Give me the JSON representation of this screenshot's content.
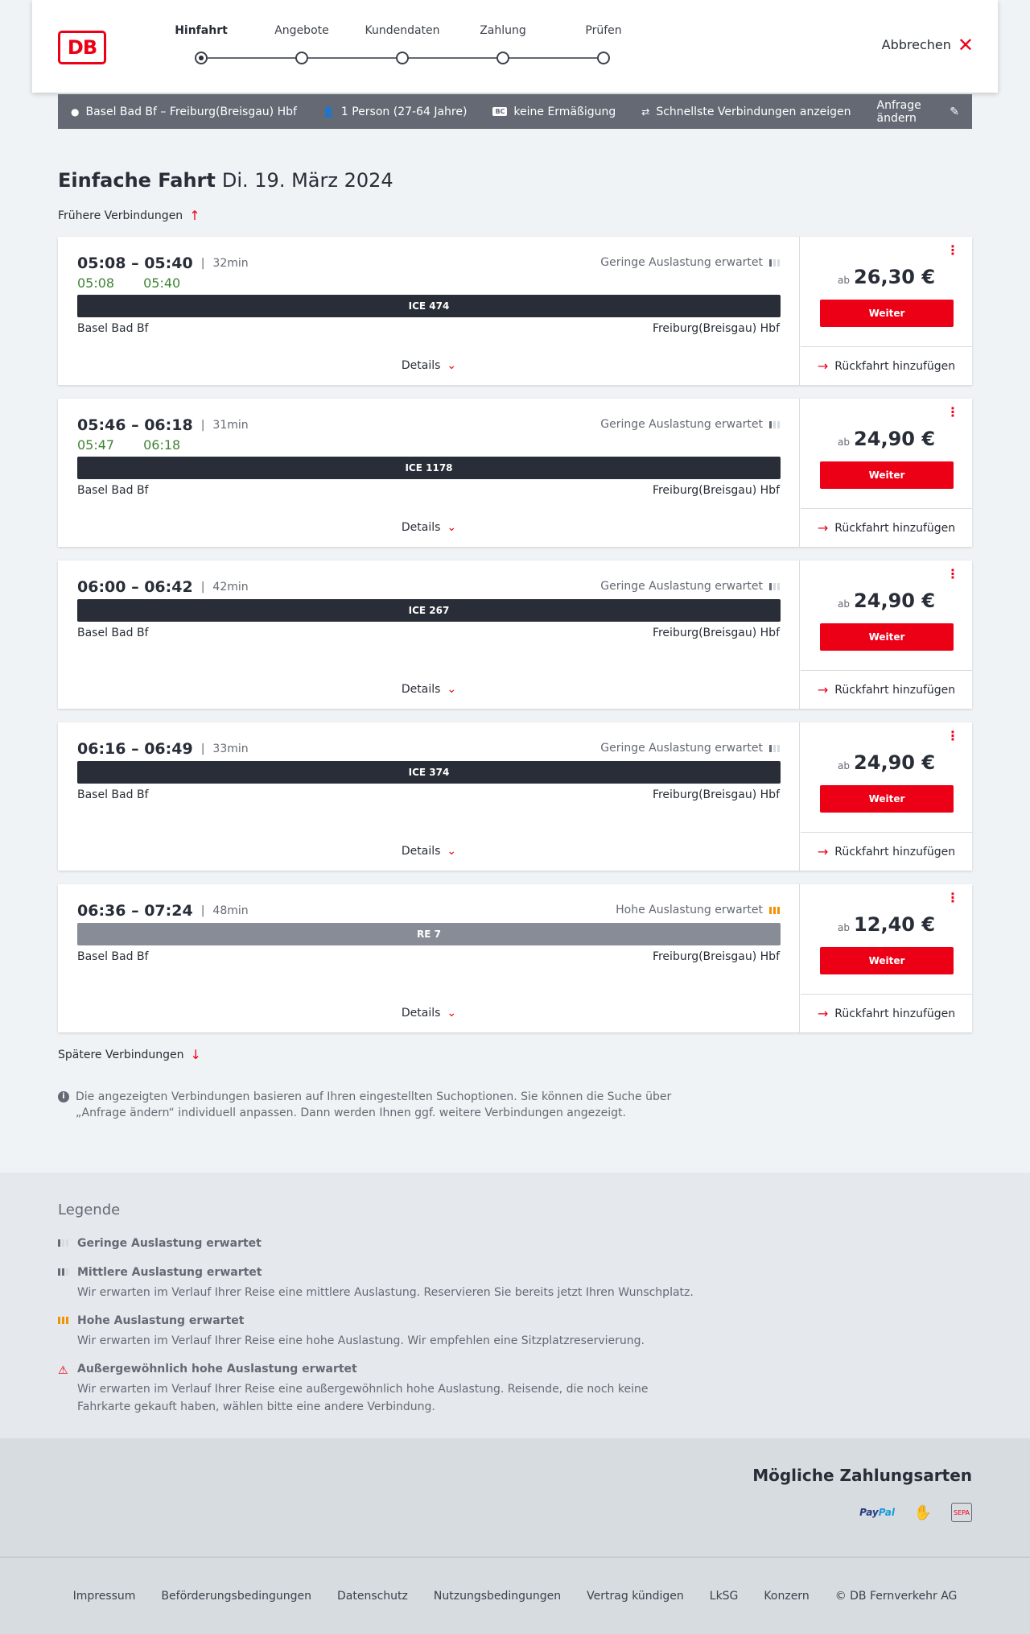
{
  "header": {
    "logo": "DB",
    "steps": [
      "Hinfahrt",
      "Angebote",
      "Kundendaten",
      "Zahlung",
      "Prüfen"
    ],
    "active_step": "Hinfahrt",
    "cancel_label": "Abbrechen"
  },
  "search": {
    "route": "Basel Bad Bf – Freiburg(Breisgau) Hbf",
    "passengers": "1 Person (27-64 Jahre)",
    "discount": "keine Ermäßigung",
    "fastest": "Schnellste Verbindungen anzeigen",
    "change": "Anfrage ändern",
    "bc_badge": "BC"
  },
  "page": {
    "title": "Einfache Fahrt",
    "date": "Di. 19. März 2024",
    "earlier": "Frühere Verbindungen",
    "later": "Spätere Verbindungen",
    "info": "Die angezeigten Verbindungen basieren auf Ihren eingestellten Suchoptionen. Sie können die Suche über „Anfrage ändern“ individuell anpassen. Dann werden Ihnen ggf. weitere Verbindungen angezeigt."
  },
  "connections": [
    {
      "times": "05:08 – 05:40",
      "duration": "32min",
      "realtime_dep": "05:08",
      "realtime_arr": "05:40",
      "load": "Geringe Auslastung erwartet",
      "train": "ICE 474",
      "from": "Basel Bad Bf",
      "to": "Freiburg(Breisgau) Hbf",
      "details": "Details",
      "ab": "ab",
      "price": "26,30 €",
      "weiter": "Weiter",
      "return": "Rückfahrt hinzufügen"
    },
    {
      "times": "05:46 – 06:18",
      "duration": "31min",
      "realtime_dep": "05:47",
      "realtime_arr": "06:18",
      "load": "Geringe Auslastung erwartet",
      "train": "ICE 1178",
      "from": "Basel Bad Bf",
      "to": "Freiburg(Breisgau) Hbf",
      "details": "Details",
      "ab": "ab",
      "price": "24,90 €",
      "weiter": "Weiter",
      "return": "Rückfahrt hinzufügen"
    },
    {
      "times": "06:00 – 06:42",
      "duration": "42min",
      "load": "Geringe Auslastung erwartet",
      "train": "ICE 267",
      "from": "Basel Bad Bf",
      "to": "Freiburg(Breisgau) Hbf",
      "details": "Details",
      "ab": "ab",
      "price": "24,90 €",
      "weiter": "Weiter",
      "return": "Rückfahrt hinzufügen"
    },
    {
      "times": "06:16 – 06:49",
      "duration": "33min",
      "load": "Geringe Auslastung erwartet",
      "train": "ICE 374",
      "from": "Basel Bad Bf",
      "to": "Freiburg(Breisgau) Hbf",
      "details": "Details",
      "ab": "ab",
      "price": "24,90 €",
      "weiter": "Weiter",
      "return": "Rückfahrt hinzufügen"
    },
    {
      "times": "06:36 – 07:24",
      "duration": "48min",
      "load": "Hohe Auslastung erwartet",
      "train": "RE 7",
      "from": "Basel Bad Bf",
      "to": "Freiburg(Breisgau) Hbf",
      "details": "Details",
      "ab": "ab",
      "price": "12,40 €",
      "weiter": "Weiter",
      "return": "Rückfahrt hinzufügen"
    }
  ],
  "legend": {
    "title": "Legende",
    "items": [
      {
        "title": "Geringe Auslastung erwartet",
        "desc": ""
      },
      {
        "title": "Mittlere Auslastung erwartet",
        "desc": "Wir erwarten im Verlauf Ihrer Reise eine mittlere Auslastung. Reservieren Sie bereits jetzt Ihren Wunschplatz."
      },
      {
        "title": "Hohe Auslastung erwartet",
        "desc": "Wir erwarten im Verlauf Ihrer Reise eine hohe Auslastung. Wir empfehlen eine Sitzplatzreservierung."
      },
      {
        "title": "Außergewöhnlich hohe Auslastung erwartet",
        "desc": "Wir erwarten im Verlauf Ihrer Reise eine außergewöhnlich hohe Auslastung. Reisende, die noch keine Fahrkarte gekauft haben, wählen bitte eine andere Verbindung."
      }
    ]
  },
  "payment": {
    "title": "Mögliche Zahlungsarten",
    "paypal_a": "Pay",
    "paypal_b": "Pal",
    "sepa": "SEPA"
  },
  "footer": [
    "Impressum",
    "Beförderungsbedingungen",
    "Datenschutz",
    "Nutzungsbedingungen",
    "Vertrag kündigen",
    "LkSG",
    "Konzern",
    "© DB Fernverkehr AG"
  ],
  "colors": {
    "accent": "#ec0016",
    "realtime": "#408335",
    "high_load": "#f39200",
    "train_bar": "#282d37",
    "regional_bar": "#878c96"
  }
}
